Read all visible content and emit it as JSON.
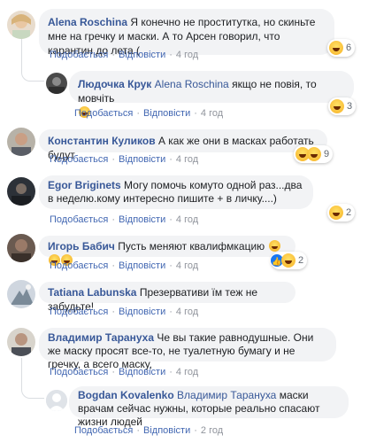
{
  "comments": [
    {
      "author": "Alena Roschina",
      "text": "Я конечно не проститутка, но скиньте мне на гречку и маски. А то Арсен говорил, что карантин до лета (",
      "like": "Подобається",
      "reply": "Відповісти",
      "time": "4 год",
      "reactions": "6"
    },
    {
      "author": "Людочка Крук",
      "mention": "Alena Roschina",
      "text": "якщо не повія, то мовчіть",
      "like": "Подобається",
      "reply": "Відповісти",
      "time": "4 год",
      "reactions": "3"
    },
    {
      "author": "Константин Куликов",
      "text": "А как же они в масках работать будут",
      "like": "Подобається",
      "reply": "Відповісти",
      "time": "4 год",
      "reactions": "9"
    },
    {
      "author": "Egor Briginets",
      "text": "Могу помочь комуто одной раз...два в неделю.кому интересно пишите + в личку....)",
      "like": "Подобається",
      "reply": "Відповісти",
      "time": "4 год",
      "reactions": "2"
    },
    {
      "author": "Игорь Бабич",
      "text": "Пусть меняют квалифмкацию",
      "like": "Подобається",
      "reply": "Відповісти",
      "time": "4 год",
      "reactions": "2"
    },
    {
      "author": "Tatiana Labunska",
      "text": "Презервативи їм теж не забудьте!",
      "like": "Подобається",
      "reply": "Відповісти",
      "time": "4 год"
    },
    {
      "author": "Владимир Тарануха",
      "text": "Че вы такие равнодушные. Они же маску просят все-то, не туалетную бумагу и не гречку, а всего маску,",
      "like": "Подобається",
      "reply": "Відповісти",
      "time": "4 год"
    },
    {
      "author": "Bogdan Kovalenko",
      "mention": "Владимир Тарануха",
      "text": "маски врачам сейчас нужны, которые реально спасают жизни людей",
      "like": "Подобається",
      "reply": "Відповісти",
      "time": "2 год"
    }
  ]
}
